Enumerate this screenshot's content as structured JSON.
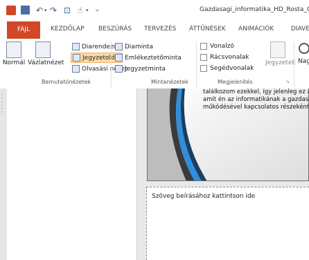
{
  "window": {
    "title": "Gazdasagi_informatika_HD_Rosta_Ga"
  },
  "tabs": [
    "FÁJL",
    "KEZDŐLAP",
    "BESZÚRÁS",
    "TERVEZÉS",
    "ÁTTŰNÉSEK",
    "ANIMÁCIÓK",
    "DIAVE"
  ],
  "ribbon": {
    "presentation_views": {
      "label": "Bemutatónézetek",
      "normal": "Normál",
      "outline": "Vázlatnézet",
      "slide_sorter": "Diarendező",
      "notes_page": "Jegyzetoldal",
      "reading_view": "Olvasási nézet"
    },
    "master_views": {
      "label": "Mintanézetek",
      "slide_master": "Diaminta",
      "handout_master": "Emlékeztetőminta",
      "notes_master": "Jegyzetminta"
    },
    "show": {
      "label": "Megjelenítés",
      "ruler": "Vonalzó",
      "gridlines": "Rácsvonalak",
      "guides": "Segédvonalak",
      "notes_button": "Jegyzetek",
      "zoom_partial": "Nag"
    }
  },
  "slide": {
    "lines": [
      "találkozom ezekkel, így jelenleg ez á",
      "amit én az informatikának a gazdasá",
      "működésével kapcsolatos részeként"
    ]
  },
  "notes": {
    "placeholder": "Szöveg beírásához kattintson ide"
  },
  "colors": {
    "file_tab": "#d24726",
    "accent_blue": "#2e8fdc",
    "dark_swoosh": "#3a3a3a"
  }
}
